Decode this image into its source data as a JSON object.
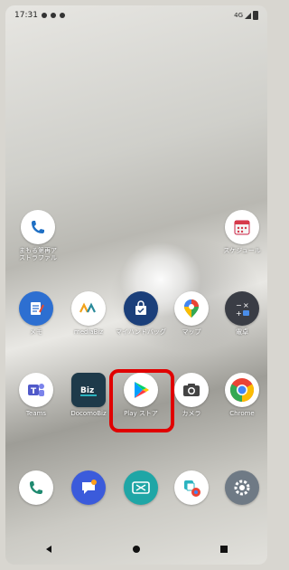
{
  "status": {
    "time": "17:31",
    "right_text": "4G"
  },
  "apps": {
    "row1_left": {
      "label": "まもる第再ア\nストラファル"
    },
    "row1_right": {
      "label": "スケジュール"
    },
    "row2": [
      {
        "label": "メモ"
      },
      {
        "label": "mediaBiz"
      },
      {
        "label": "マイハンドバッグ"
      },
      {
        "label": "マップ"
      },
      {
        "label": "電卓"
      }
    ],
    "row3": [
      {
        "label": "Teams"
      },
      {
        "label": "DocomoBiz"
      },
      {
        "label": "Play ストア"
      },
      {
        "label": "カメラ"
      },
      {
        "label": "Chrome"
      }
    ]
  },
  "colors": {
    "highlight": "#e00000"
  }
}
